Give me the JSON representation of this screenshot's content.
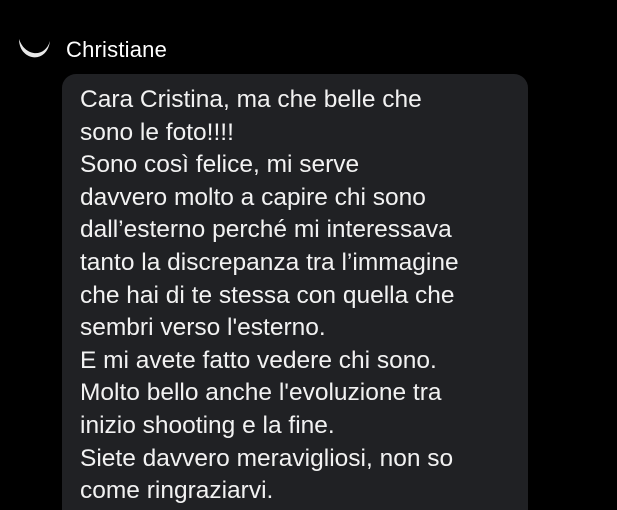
{
  "sender": {
    "name": "Christiane",
    "avatar_icon": "avatar-crescent-icon"
  },
  "message": {
    "lines": [
      "Cara Cristina, ma che belle che",
      "sono le foto!!!!",
      "Sono così felice, mi serve",
      "davvero molto a capire chi sono",
      "dall’esterno perché mi interessava",
      "tanto la discrepanza tra l’immagine",
      "che hai di te stessa con quella che",
      "sembri verso l'esterno.",
      "E mi avete fatto vedere chi sono.",
      "Molto bello anche l'evoluzione tra",
      "inizio shooting e la fine.",
      "Siete davvero meravigliosi, non so",
      "come ringraziarvi."
    ]
  },
  "colors": {
    "background": "#000000",
    "bubble": "#202124",
    "text": "#f2f2f2"
  }
}
